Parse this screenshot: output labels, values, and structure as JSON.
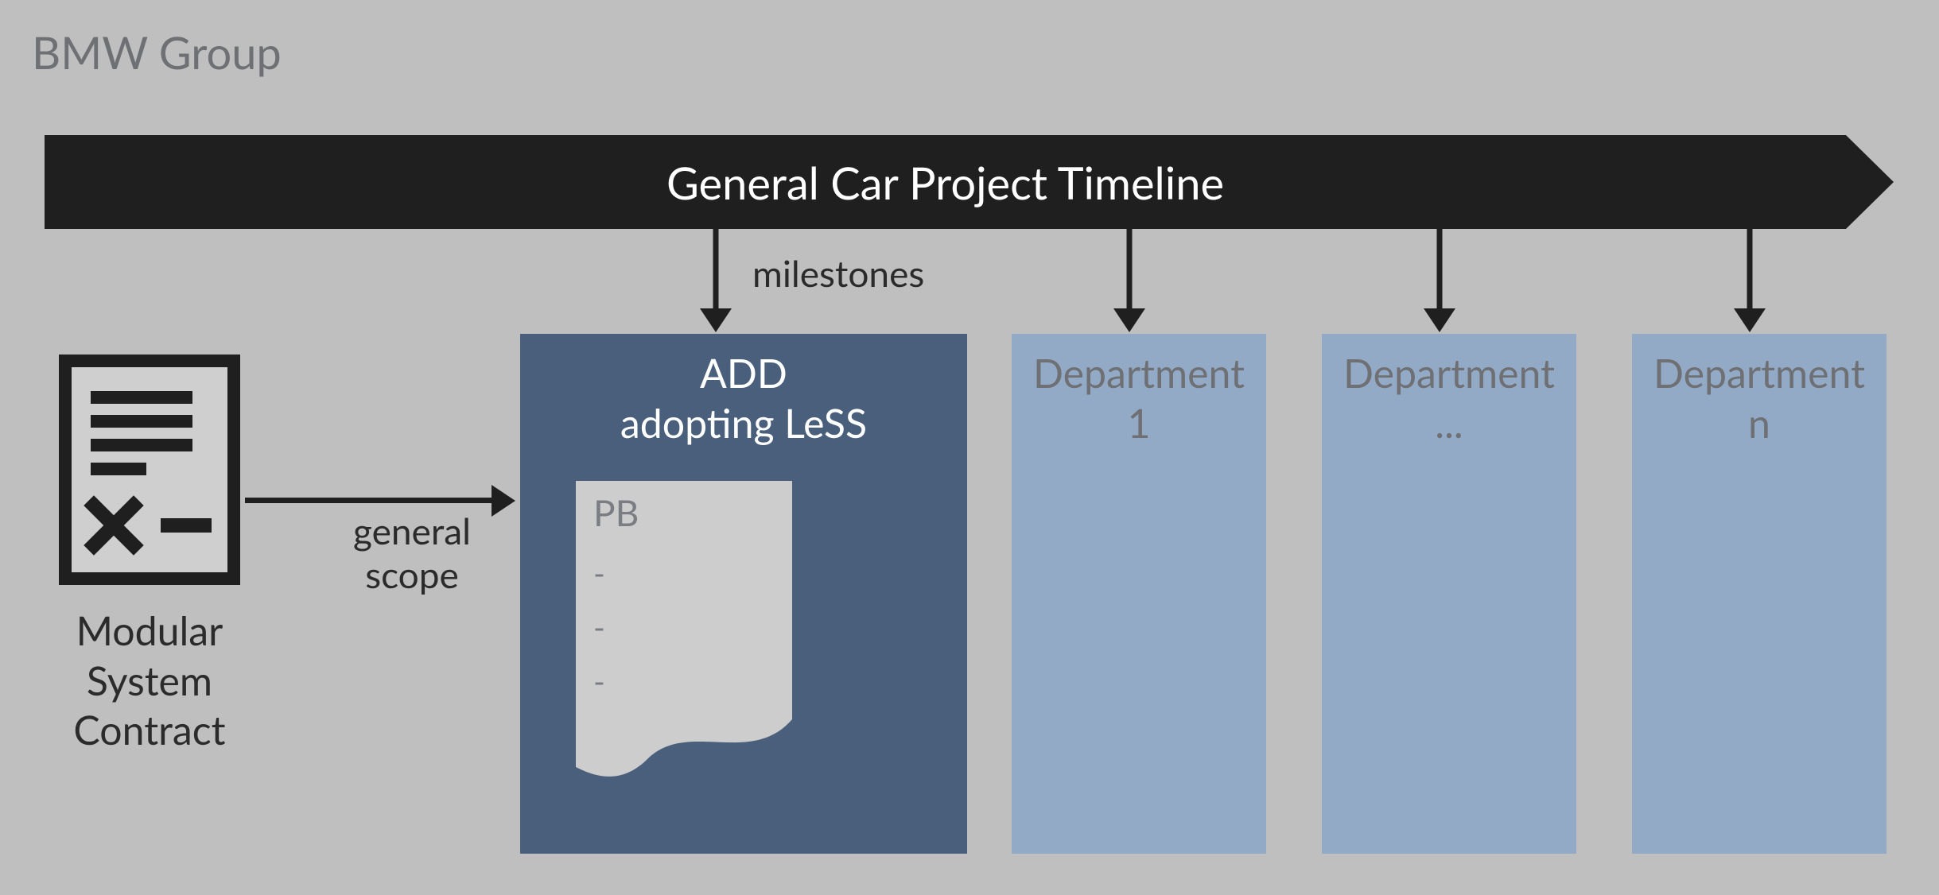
{
  "org_title": "BMW Group",
  "timeline": {
    "title": "General Car Project Timeline",
    "milestones_label": "milestones"
  },
  "contract": {
    "caption": "Modular System Contract",
    "arrow_label": "general scope"
  },
  "main_dept": {
    "line1": "ADD",
    "line2": "adopting LeSS",
    "pb_label": "PB",
    "pb_items": [
      "-",
      "-",
      "-"
    ]
  },
  "other_depts": [
    {
      "line1": "Department",
      "line2": "1"
    },
    {
      "line1": "Department",
      "line2": "..."
    },
    {
      "line1": "Department",
      "line2": "n"
    }
  ],
  "colors": {
    "canvas_bg": "#bfbfbf",
    "timeline_bg": "#1f1f1f",
    "timeline_text": "#ffffff",
    "dept_main_bg": "#4a5f7b",
    "dept_fade_bg": "#93aac7",
    "muted_text": "#6e7074",
    "body_text": "#2b2b2b",
    "pb_fill": "#cdcdcd"
  }
}
